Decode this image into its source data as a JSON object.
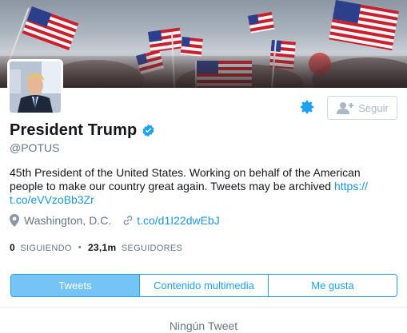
{
  "profile": {
    "name": "President Trump",
    "handle": "@POTUS",
    "bio": "45th President of the United States. Working on behalf of the American people to make our country great again. Tweets may be archived ",
    "bio_link_line1": "https://",
    "bio_link_line2": "t.co/eVVzoBb3Zr",
    "location": "Washington, D.C.",
    "website": "t.co/d1I22dwEbJ"
  },
  "stats": {
    "following_count": "0",
    "following_label": "SIGUIENDO",
    "followers_count": "23,1m",
    "followers_label": "SEGUIDORES"
  },
  "actions": {
    "follow_label": "Seguir",
    "settings_icon": "gear-icon",
    "follow_icon": "add-user-icon"
  },
  "tabs": [
    {
      "label": "Tweets",
      "active": true
    },
    {
      "label": "Contenido multimedia",
      "active": false
    },
    {
      "label": "Me gusta",
      "active": false
    }
  ],
  "empty_state": "Ningún Tweet",
  "colors": {
    "accent": "#1da1f2",
    "link": "#1b95e0",
    "active_tab": "#75c4f5",
    "muted": "#657786",
    "verified": "#1da1f2"
  }
}
